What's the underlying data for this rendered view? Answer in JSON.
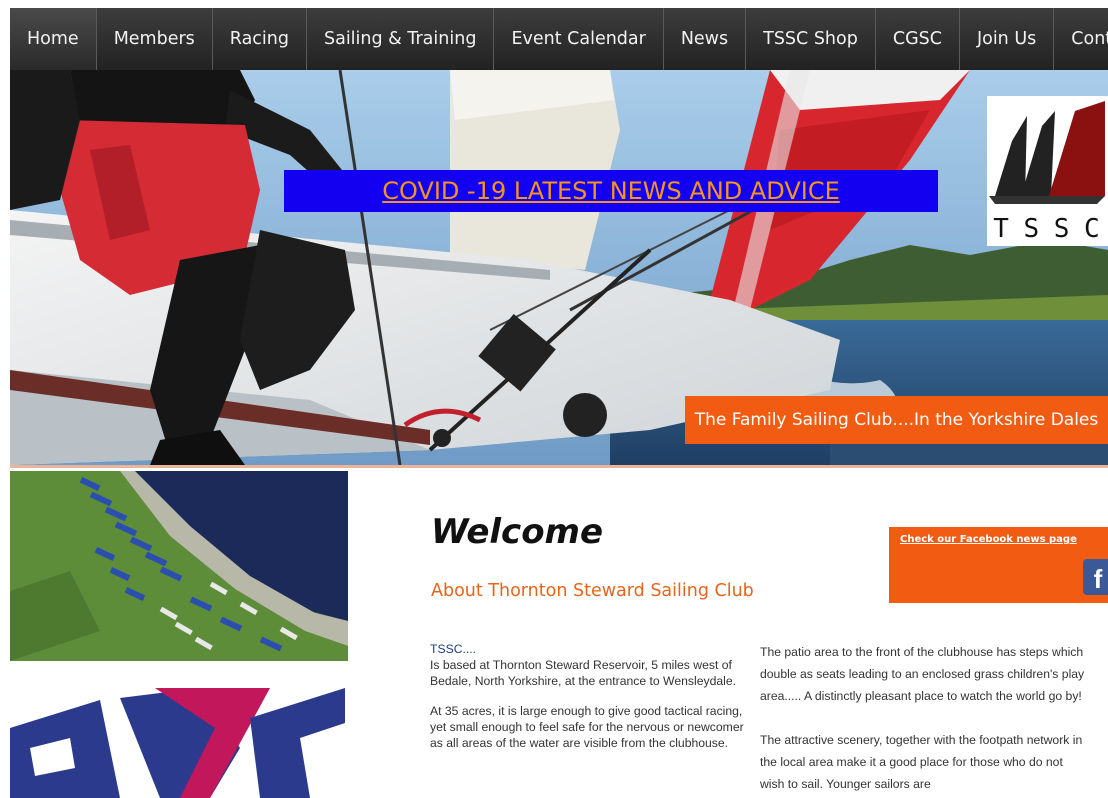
{
  "nav": {
    "items": [
      {
        "label": "Home"
      },
      {
        "label": "Members"
      },
      {
        "label": "Racing"
      },
      {
        "label": "Sailing & Training"
      },
      {
        "label": "Event Calendar"
      },
      {
        "label": "News"
      },
      {
        "label": "TSSC Shop"
      },
      {
        "label": "CGSC"
      },
      {
        "label": "Join Us"
      },
      {
        "label": "Contact"
      }
    ]
  },
  "hero": {
    "covid_link": "COVID -19 LATEST NEWS AND ADVICE",
    "tagline": "The Family Sailing Club....In the Yorkshire Dales",
    "logo_letters": [
      "T",
      "S",
      "S",
      "C"
    ]
  },
  "main": {
    "welcome": "Welcome",
    "subtitle": "About Thornton Steward Sailing Club",
    "facebook_link": "Check our Facebook news page",
    "left": {
      "heading": "TSSC....",
      "p1": "Is based at Thornton Steward Reservoir, 5 miles west of Bedale, North Yorkshire, at the entrance to Wensleydale.",
      "p2": "At 35 acres, it is large enough to give good tactical racing, yet small enough to feel safe for the nervous or newcomer as all areas of the water are visible from the clubhouse."
    },
    "right": {
      "p1": "The patio area to the front of the clubhouse has steps which double as seats leading to an enclosed grass children's play area..... A distinctly pleasant place to watch the world go by!",
      "p2": "The attractive scenery, together with the footpath network in the local area make it a good place for those who do not wish to sail.  Younger sailors are"
    }
  },
  "colors": {
    "accent_orange": "#f25c12",
    "covid_blue": "#1400f0",
    "nav_bg": "#2c2c2c",
    "logo_red": "#8b1010"
  }
}
